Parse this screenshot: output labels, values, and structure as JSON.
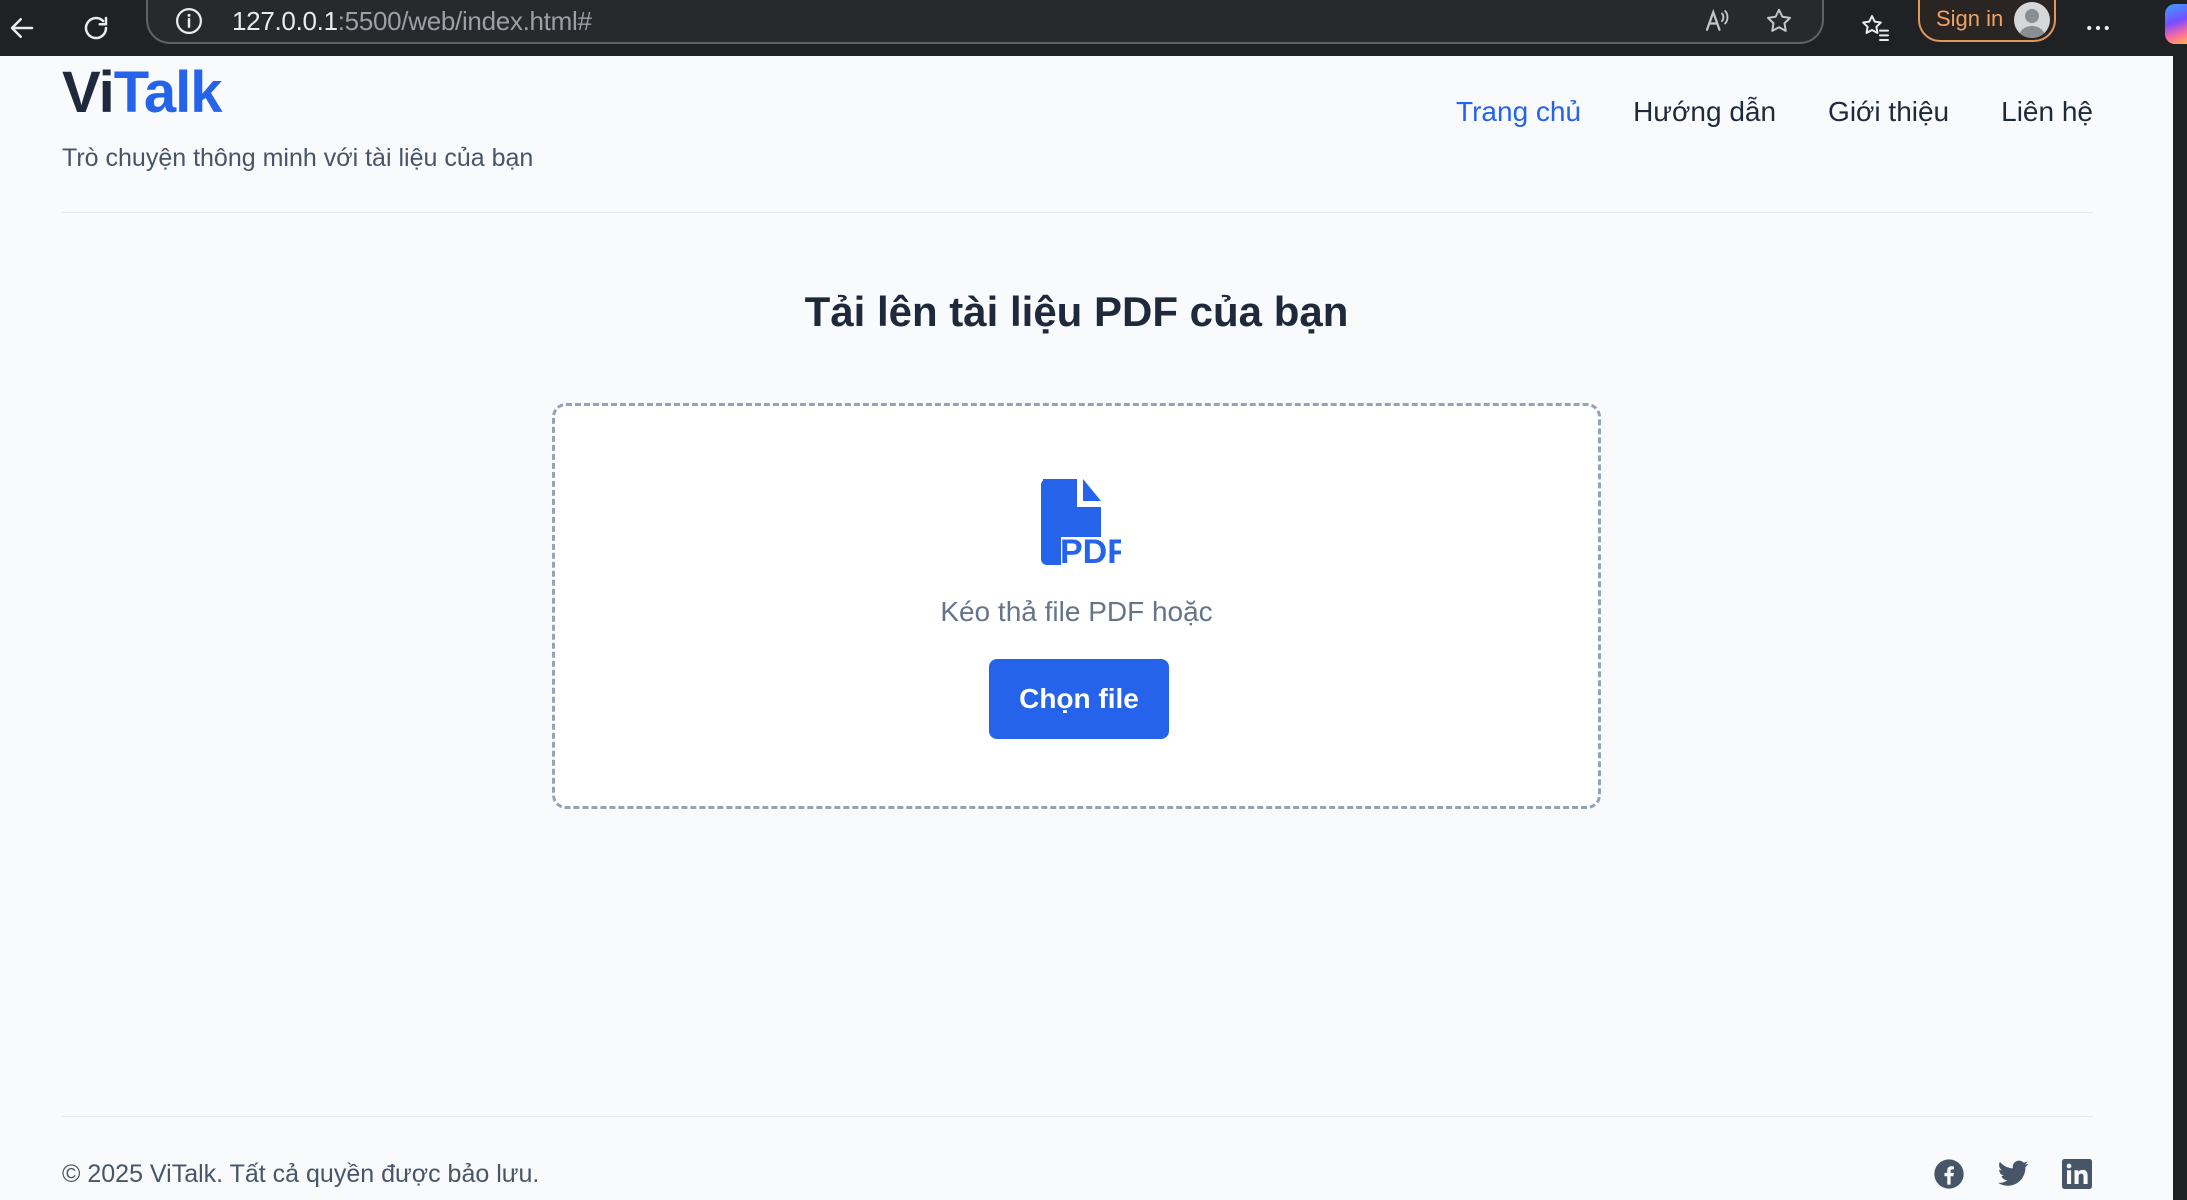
{
  "browser": {
    "url_host": "127.0.0.1",
    "url_rest": ":5500/web/index.html#",
    "signin_label": "Sign in"
  },
  "header": {
    "logo_part1": "Vi",
    "logo_part2": "Talk",
    "tagline": "Trò chuyện thông minh với tài liệu của bạn",
    "nav": [
      {
        "label": "Trang chủ",
        "active": true
      },
      {
        "label": "Hướng dẫn",
        "active": false
      },
      {
        "label": "Giới thiệu",
        "active": false
      },
      {
        "label": "Liên hệ",
        "active": false
      }
    ]
  },
  "upload": {
    "title": "Tải lên tài liệu PDF của bạn",
    "icon": "pdf-file-icon",
    "icon_label": "PDF",
    "drop_text": "Kéo thả file PDF hoặc",
    "button_label": "Chọn file"
  },
  "footer": {
    "copyright": "© 2025 ViTalk. Tất cả quyền được bảo lưu.",
    "socials": [
      "facebook-icon",
      "twitter-icon",
      "linkedin-icon"
    ]
  },
  "colors": {
    "accent": "#2563eb",
    "text_dark": "#1e293b",
    "text_muted": "#64748b",
    "background": "#f8fafc"
  }
}
